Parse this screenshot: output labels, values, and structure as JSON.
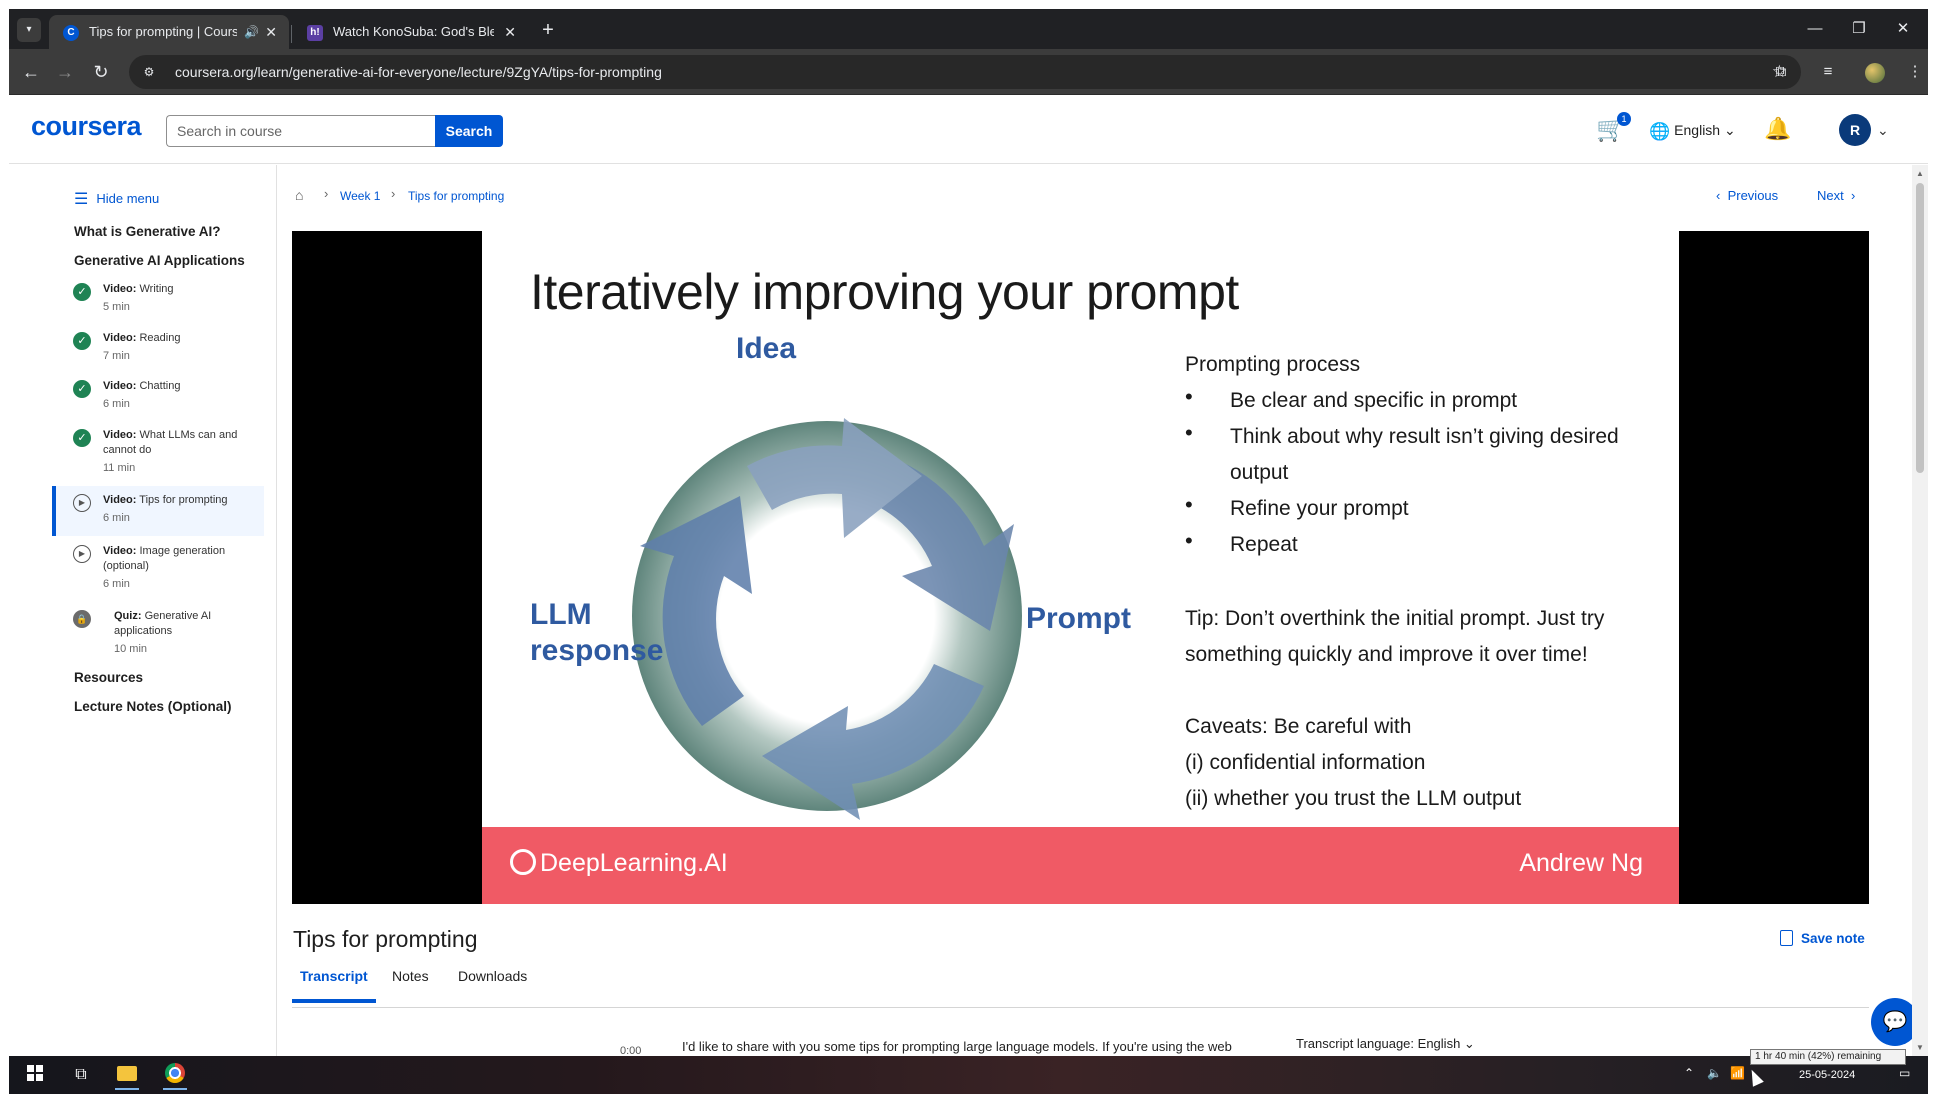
{
  "browser": {
    "tabs": [
      {
        "favicon": "C",
        "title": "Tips for prompting | Coursera"
      },
      {
        "favicon": "h!",
        "title": "Watch KonoSuba: God's Blessing on This Wonderful World!"
      }
    ],
    "url": "coursera.org/learn/generative-ai-for-everyone/lecture/9ZgYA/tips-for-prompting"
  },
  "header": {
    "logo": "coursera",
    "search_placeholder": "Search in course",
    "search_button": "Search",
    "cart_count": "1",
    "language": "English",
    "avatar_initial": "R"
  },
  "sidebar": {
    "hide_menu": "Hide menu",
    "section_1": "What is Generative AI?",
    "section_2": "Generative AI Applications",
    "lessons": [
      {
        "type": "Video:",
        "title": "Writing",
        "duration": "5 min",
        "status": "completed"
      },
      {
        "type": "Video:",
        "title": "Reading",
        "duration": "7 min",
        "status": "completed"
      },
      {
        "type": "Video:",
        "title": "Chatting",
        "duration": "6 min",
        "status": "completed"
      },
      {
        "type": "Video:",
        "title": "What LLMs can and cannot do",
        "duration": "11 min",
        "status": "completed"
      },
      {
        "type": "Video:",
        "title": "Tips for prompting",
        "duration": "6 min",
        "status": "current"
      },
      {
        "type": "Video:",
        "title": "Image generation (optional)",
        "duration": "6 min",
        "status": "not-started"
      },
      {
        "type": "Quiz:",
        "title": "Generative AI applications",
        "duration": "10 min",
        "status": "locked"
      }
    ],
    "section_3": "Resources",
    "section_4": "Lecture Notes (Optional)"
  },
  "breadcrumb": {
    "week": "Week 1",
    "current": "Tips for prompting"
  },
  "nav": {
    "previous": "Previous",
    "next": "Next"
  },
  "slide": {
    "title": "Iteratively improving your prompt",
    "cycle_labels": {
      "top": "Idea",
      "right": "Prompt",
      "left": "LLM response"
    },
    "process_heading": "Prompting process",
    "bullets": [
      "Be clear and specific in prompt",
      "Think about why result isn’t giving desired output",
      "Refine your prompt",
      "Repeat"
    ],
    "tip": "Tip: Don’t overthink the initial prompt. Just try something quickly and improve it over time!",
    "caveats": [
      "Caveats: Be careful with",
      "(i) confidential information",
      "(ii) whether you trust the LLM output"
    ],
    "footer_brand": "DeepLearning.AI",
    "footer_presenter": "Andrew Ng"
  },
  "content": {
    "video_title": "Tips for prompting",
    "save_note": "Save note",
    "tabs": [
      "Transcript",
      "Notes",
      "Downloads"
    ],
    "transcript_time": "0:00",
    "transcript_text": "I'd like to share with you some tips for prompting large language models. If you're using the web",
    "transcript_language_label": "Transcript language:",
    "transcript_language": "English"
  },
  "taskbar": {
    "date": "25-05-2024",
    "battery_tooltip": "1 hr 40 min (42%) remaining"
  },
  "colors": {
    "brand": "#0056d2",
    "completed": "#1f8354",
    "slide_footer": "#f05a65",
    "cycle_label": "#2f5aa0"
  }
}
